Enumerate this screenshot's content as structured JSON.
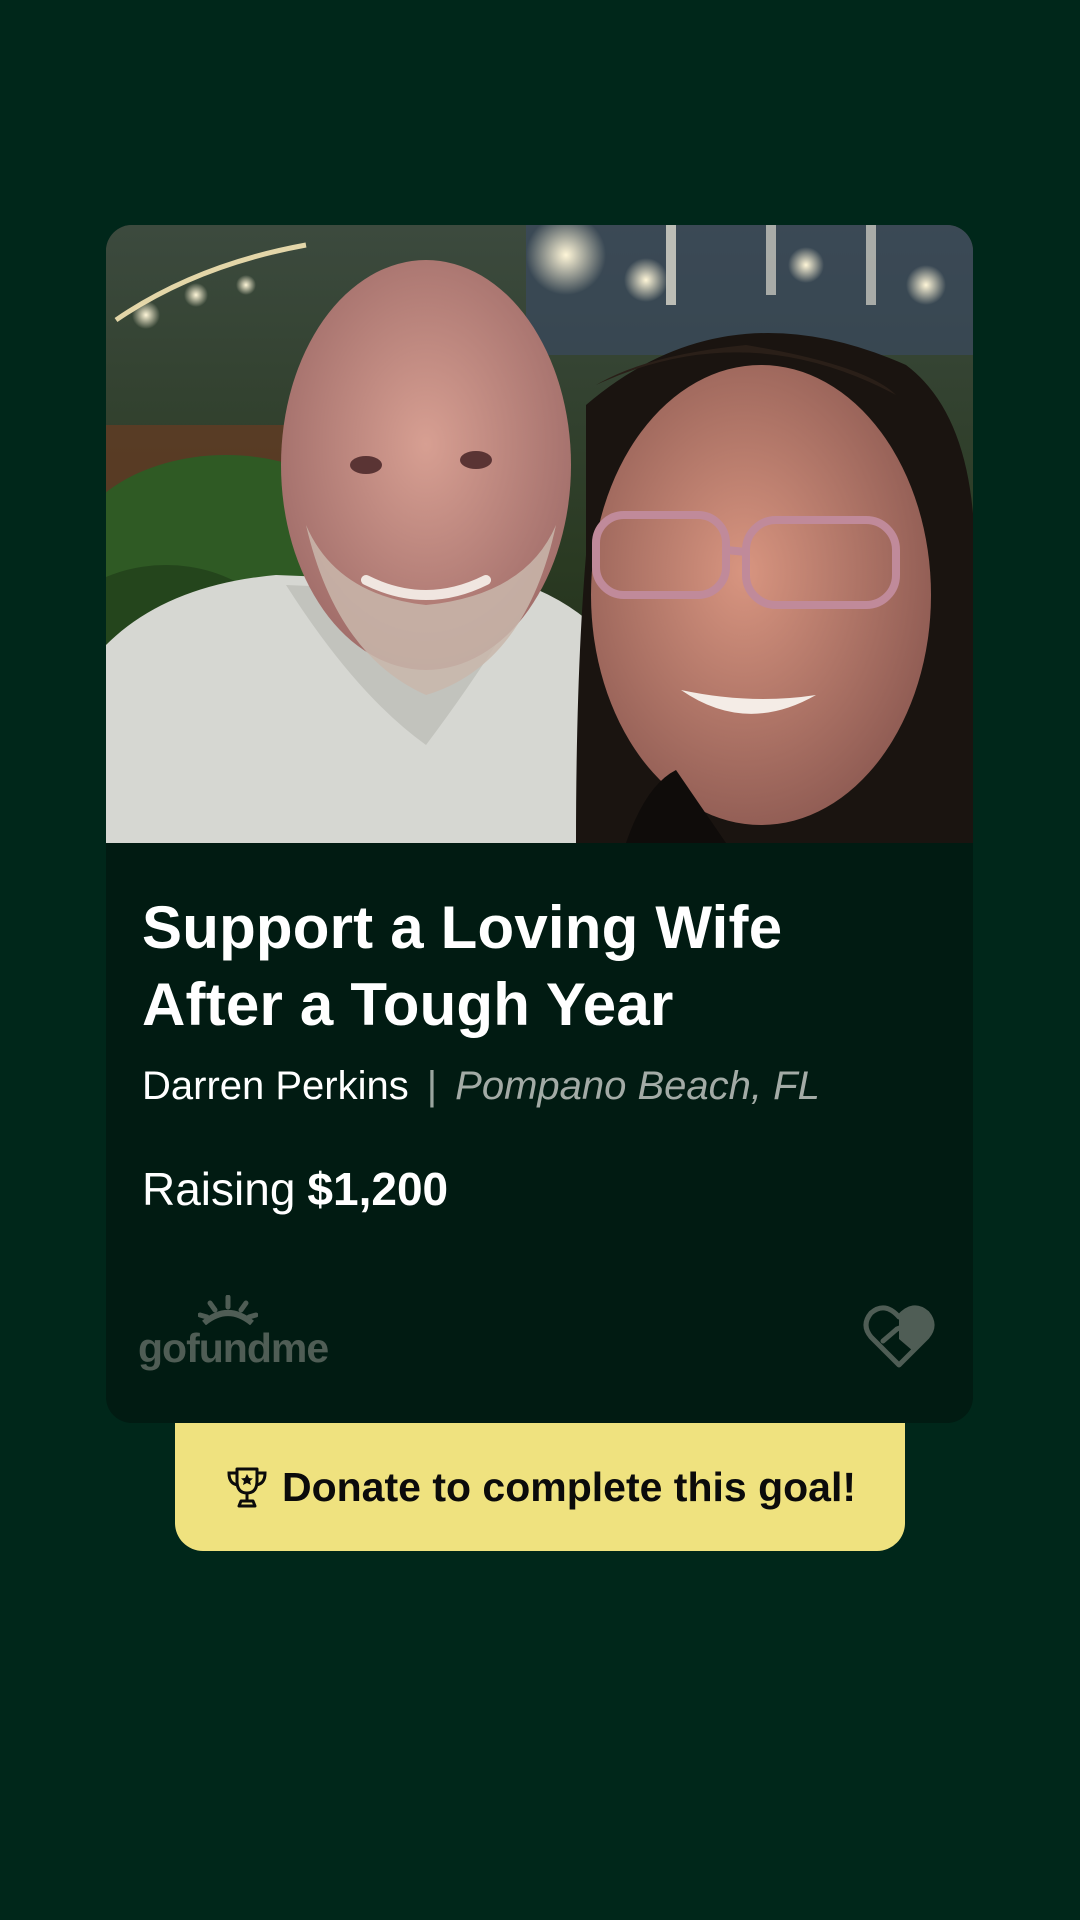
{
  "card": {
    "photo_alt": "",
    "title": "Support a Loving Wife After a Tough  Year",
    "organizer": "Darren Perkins",
    "separator": "|",
    "location": "Pompano Beach, FL",
    "raising_label": "Raising",
    "raising_amount": "$1,200",
    "logo_text": "gofundme"
  },
  "donate_button": {
    "label": "Donate to complete this goal!"
  },
  "icons": {
    "logo": "gofundme-sun-icon",
    "heart": "heart-handshake-icon",
    "trophy": "trophy-icon"
  },
  "colors": {
    "background": "#00271a",
    "card": "#011b12",
    "button": "#efe27f",
    "muted": "#a3aba6"
  }
}
